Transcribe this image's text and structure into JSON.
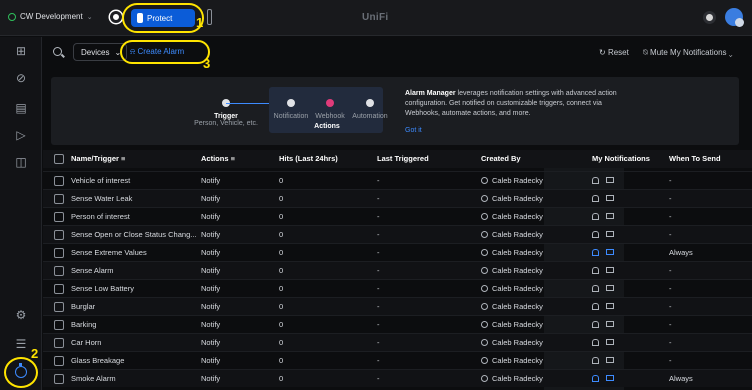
{
  "topbar": {
    "site_name": "CW Development",
    "app_button": "Protect",
    "brand": "UniFi"
  },
  "annotations": {
    "one": "1",
    "two": "2",
    "three": "3"
  },
  "toolbar": {
    "devices_filter": "Devices",
    "create_alarm": "Create Alarm",
    "reset": "Reset",
    "mute": "Mute My Notifications"
  },
  "banner": {
    "trigger_title": "Trigger",
    "trigger_sub": "Person, Vehicle, etc.",
    "notification": "Notification",
    "webhook": "Webhook",
    "automation": "Automation",
    "actions": "Actions",
    "text_bold": "Alarm Manager",
    "text_rest": " leverages notification settings with advanced action configuration. Get notified on customizable triggers, connect via Webhooks, automate actions, and more.",
    "got_it": "Got it"
  },
  "table": {
    "headers": {
      "name": "Name/Trigger",
      "actions": "Actions",
      "hits": "Hits (Last 24hrs)",
      "last": "Last Triggered",
      "created": "Created By",
      "notif": "My Notifications",
      "when": "When To Send"
    },
    "rows": [
      {
        "name": "Vehicle of interest",
        "action": "Notify",
        "hits": "0",
        "last": "-",
        "by": "Caleb Radecky",
        "bell_on": false,
        "when": "-"
      },
      {
        "name": "Sense Water Leak",
        "action": "Notify",
        "hits": "0",
        "last": "-",
        "by": "Caleb Radecky",
        "bell_on": false,
        "when": "-"
      },
      {
        "name": "Person of interest",
        "action": "Notify",
        "hits": "0",
        "last": "-",
        "by": "Caleb Radecky",
        "bell_on": false,
        "when": "-"
      },
      {
        "name": "Sense Open or Close Status Chang...",
        "action": "Notify",
        "hits": "0",
        "last": "-",
        "by": "Caleb Radecky",
        "bell_on": false,
        "when": "-"
      },
      {
        "name": "Sense Extreme Values",
        "action": "Notify",
        "hits": "0",
        "last": "-",
        "by": "Caleb Radecky",
        "bell_on": true,
        "when": "Always"
      },
      {
        "name": "Sense Alarm",
        "action": "Notify",
        "hits": "0",
        "last": "-",
        "by": "Caleb Radecky",
        "bell_on": false,
        "when": "-"
      },
      {
        "name": "Sense Low Battery",
        "action": "Notify",
        "hits": "0",
        "last": "-",
        "by": "Caleb Radecky",
        "bell_on": false,
        "when": "-"
      },
      {
        "name": "Burglar",
        "action": "Notify",
        "hits": "0",
        "last": "-",
        "by": "Caleb Radecky",
        "bell_on": false,
        "when": "-"
      },
      {
        "name": "Barking",
        "action": "Notify",
        "hits": "0",
        "last": "-",
        "by": "Caleb Radecky",
        "bell_on": false,
        "when": "-"
      },
      {
        "name": "Car Horn",
        "action": "Notify",
        "hits": "0",
        "last": "-",
        "by": "Caleb Radecky",
        "bell_on": false,
        "when": "-"
      },
      {
        "name": "Glass Breakage",
        "action": "Notify",
        "hits": "0",
        "last": "-",
        "by": "Caleb Radecky",
        "bell_on": false,
        "when": "-"
      },
      {
        "name": "Smoke Alarm",
        "action": "Notify",
        "hits": "0",
        "last": "-",
        "by": "Caleb Radecky",
        "bell_on": true,
        "when": "Always"
      }
    ]
  }
}
